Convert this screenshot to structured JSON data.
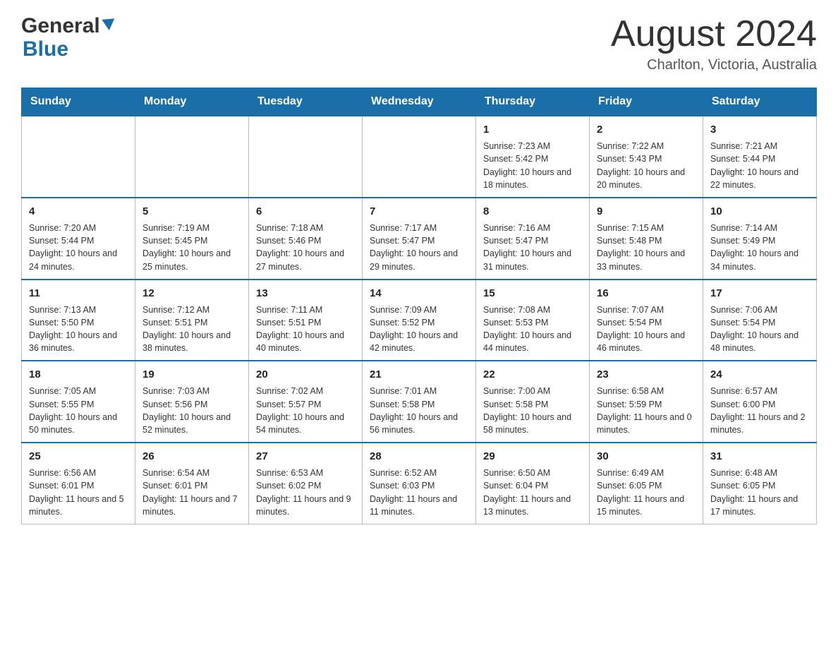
{
  "header": {
    "logo_general": "General",
    "logo_blue": "Blue",
    "month_title": "August 2024",
    "location": "Charlton, Victoria, Australia"
  },
  "days_of_week": [
    "Sunday",
    "Monday",
    "Tuesday",
    "Wednesday",
    "Thursday",
    "Friday",
    "Saturday"
  ],
  "weeks": [
    [
      {
        "day": "",
        "info": ""
      },
      {
        "day": "",
        "info": ""
      },
      {
        "day": "",
        "info": ""
      },
      {
        "day": "",
        "info": ""
      },
      {
        "day": "1",
        "info": "Sunrise: 7:23 AM\nSunset: 5:42 PM\nDaylight: 10 hours and 18 minutes."
      },
      {
        "day": "2",
        "info": "Sunrise: 7:22 AM\nSunset: 5:43 PM\nDaylight: 10 hours and 20 minutes."
      },
      {
        "day": "3",
        "info": "Sunrise: 7:21 AM\nSunset: 5:44 PM\nDaylight: 10 hours and 22 minutes."
      }
    ],
    [
      {
        "day": "4",
        "info": "Sunrise: 7:20 AM\nSunset: 5:44 PM\nDaylight: 10 hours and 24 minutes."
      },
      {
        "day": "5",
        "info": "Sunrise: 7:19 AM\nSunset: 5:45 PM\nDaylight: 10 hours and 25 minutes."
      },
      {
        "day": "6",
        "info": "Sunrise: 7:18 AM\nSunset: 5:46 PM\nDaylight: 10 hours and 27 minutes."
      },
      {
        "day": "7",
        "info": "Sunrise: 7:17 AM\nSunset: 5:47 PM\nDaylight: 10 hours and 29 minutes."
      },
      {
        "day": "8",
        "info": "Sunrise: 7:16 AM\nSunset: 5:47 PM\nDaylight: 10 hours and 31 minutes."
      },
      {
        "day": "9",
        "info": "Sunrise: 7:15 AM\nSunset: 5:48 PM\nDaylight: 10 hours and 33 minutes."
      },
      {
        "day": "10",
        "info": "Sunrise: 7:14 AM\nSunset: 5:49 PM\nDaylight: 10 hours and 34 minutes."
      }
    ],
    [
      {
        "day": "11",
        "info": "Sunrise: 7:13 AM\nSunset: 5:50 PM\nDaylight: 10 hours and 36 minutes."
      },
      {
        "day": "12",
        "info": "Sunrise: 7:12 AM\nSunset: 5:51 PM\nDaylight: 10 hours and 38 minutes."
      },
      {
        "day": "13",
        "info": "Sunrise: 7:11 AM\nSunset: 5:51 PM\nDaylight: 10 hours and 40 minutes."
      },
      {
        "day": "14",
        "info": "Sunrise: 7:09 AM\nSunset: 5:52 PM\nDaylight: 10 hours and 42 minutes."
      },
      {
        "day": "15",
        "info": "Sunrise: 7:08 AM\nSunset: 5:53 PM\nDaylight: 10 hours and 44 minutes."
      },
      {
        "day": "16",
        "info": "Sunrise: 7:07 AM\nSunset: 5:54 PM\nDaylight: 10 hours and 46 minutes."
      },
      {
        "day": "17",
        "info": "Sunrise: 7:06 AM\nSunset: 5:54 PM\nDaylight: 10 hours and 48 minutes."
      }
    ],
    [
      {
        "day": "18",
        "info": "Sunrise: 7:05 AM\nSunset: 5:55 PM\nDaylight: 10 hours and 50 minutes."
      },
      {
        "day": "19",
        "info": "Sunrise: 7:03 AM\nSunset: 5:56 PM\nDaylight: 10 hours and 52 minutes."
      },
      {
        "day": "20",
        "info": "Sunrise: 7:02 AM\nSunset: 5:57 PM\nDaylight: 10 hours and 54 minutes."
      },
      {
        "day": "21",
        "info": "Sunrise: 7:01 AM\nSunset: 5:58 PM\nDaylight: 10 hours and 56 minutes."
      },
      {
        "day": "22",
        "info": "Sunrise: 7:00 AM\nSunset: 5:58 PM\nDaylight: 10 hours and 58 minutes."
      },
      {
        "day": "23",
        "info": "Sunrise: 6:58 AM\nSunset: 5:59 PM\nDaylight: 11 hours and 0 minutes."
      },
      {
        "day": "24",
        "info": "Sunrise: 6:57 AM\nSunset: 6:00 PM\nDaylight: 11 hours and 2 minutes."
      }
    ],
    [
      {
        "day": "25",
        "info": "Sunrise: 6:56 AM\nSunset: 6:01 PM\nDaylight: 11 hours and 5 minutes."
      },
      {
        "day": "26",
        "info": "Sunrise: 6:54 AM\nSunset: 6:01 PM\nDaylight: 11 hours and 7 minutes."
      },
      {
        "day": "27",
        "info": "Sunrise: 6:53 AM\nSunset: 6:02 PM\nDaylight: 11 hours and 9 minutes."
      },
      {
        "day": "28",
        "info": "Sunrise: 6:52 AM\nSunset: 6:03 PM\nDaylight: 11 hours and 11 minutes."
      },
      {
        "day": "29",
        "info": "Sunrise: 6:50 AM\nSunset: 6:04 PM\nDaylight: 11 hours and 13 minutes."
      },
      {
        "day": "30",
        "info": "Sunrise: 6:49 AM\nSunset: 6:05 PM\nDaylight: 11 hours and 15 minutes."
      },
      {
        "day": "31",
        "info": "Sunrise: 6:48 AM\nSunset: 6:05 PM\nDaylight: 11 hours and 17 minutes."
      }
    ]
  ]
}
